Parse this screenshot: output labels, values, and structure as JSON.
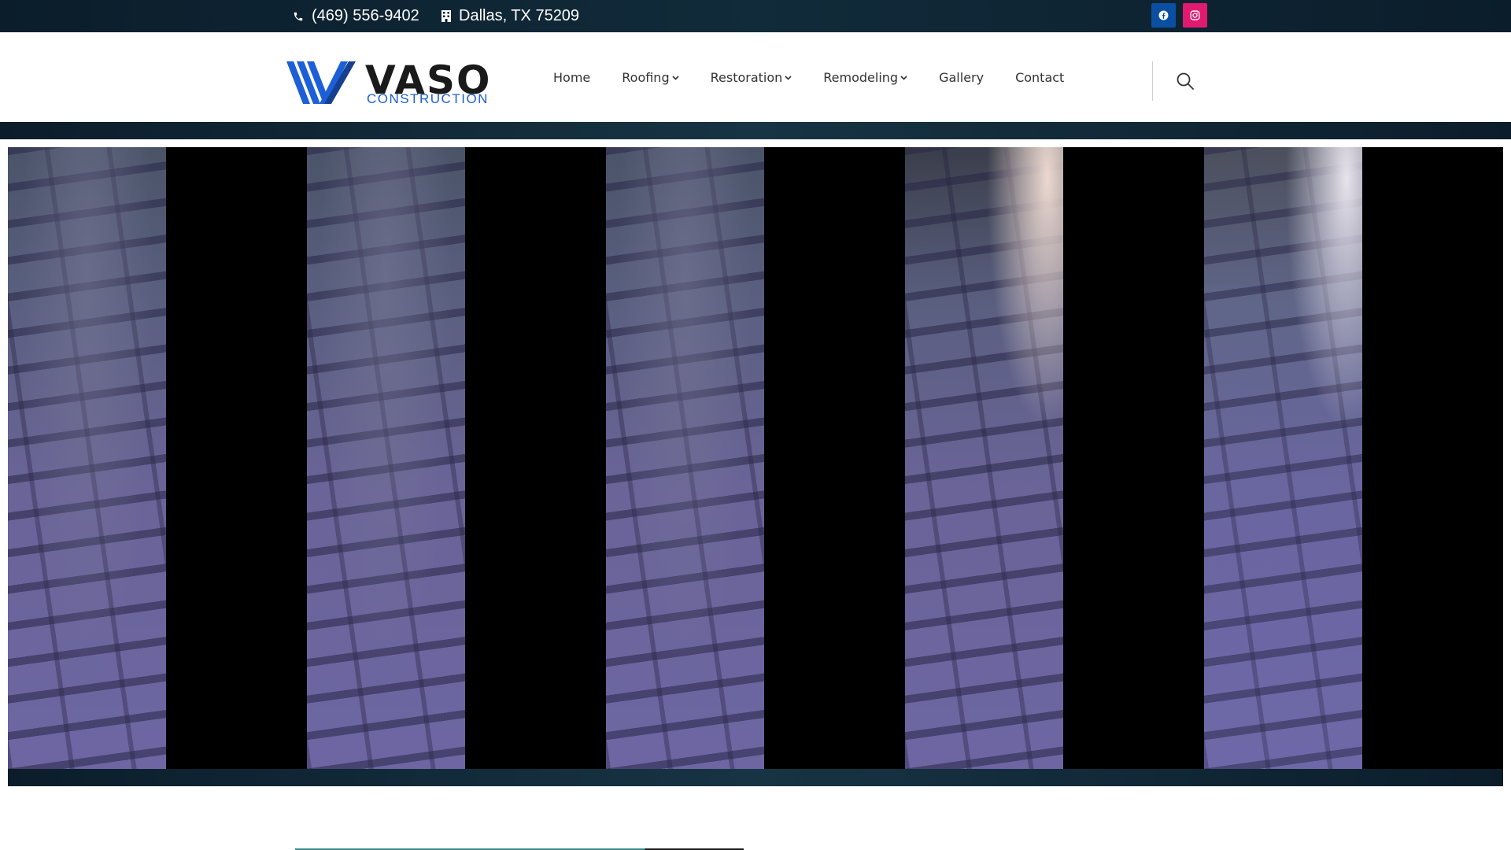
{
  "topbar": {
    "phone": "(469) 556-9402",
    "address": "Dallas, TX 75209",
    "icons": {
      "phone": "phone-icon",
      "address": "building-icon"
    },
    "social": [
      {
        "name": "facebook",
        "icon": "facebook-icon",
        "color": "#0b4fa3"
      },
      {
        "name": "instagram",
        "icon": "instagram-icon",
        "color": "#e01b6f"
      }
    ]
  },
  "header": {
    "logo": {
      "word": "VASO",
      "sub": "CONSTRUCTION",
      "accent_color": "#1d5fd6"
    },
    "nav": [
      {
        "label": "Home",
        "dropdown": false
      },
      {
        "label": "Roofing",
        "dropdown": true
      },
      {
        "label": "Restoration",
        "dropdown": true
      },
      {
        "label": "Remodeling",
        "dropdown": true
      },
      {
        "label": "Gallery",
        "dropdown": false
      },
      {
        "label": "Contact",
        "dropdown": false
      }
    ],
    "search_icon": "search-icon"
  },
  "hero": {
    "image_description": "roof shingles close-up",
    "strip_count": 5
  },
  "colors": {
    "dark_navy": "#0b1d2b",
    "nav_text": "#333333"
  }
}
